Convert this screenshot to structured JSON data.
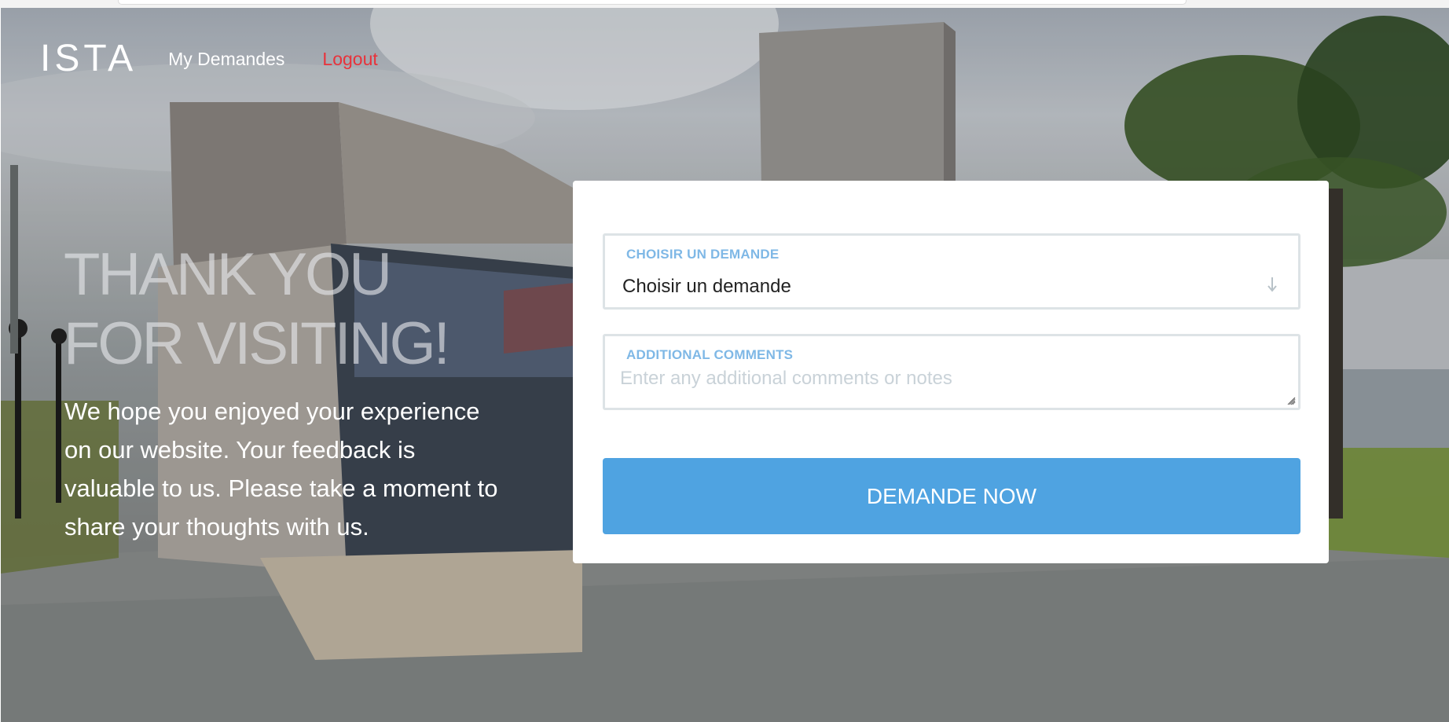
{
  "nav": {
    "logo": "ISTA",
    "links": [
      {
        "label": "My Demandes"
      },
      {
        "label": "Logout"
      }
    ]
  },
  "hero": {
    "headline_line1": "THANK YOU",
    "headline_line2": "FOR VISITING!",
    "subtext": "We hope you enjoyed your experience on our website. Your feedback is valuable to us. Please take a moment to share your thoughts with us."
  },
  "form": {
    "demande_label": "CHOISIR UN DEMANDE",
    "demande_value": "Choisir un demande",
    "comments_label": "ADDITIONAL COMMENTS",
    "comments_placeholder": "Enter any additional comments or notes",
    "submit_label": "DEMANDE NOW"
  },
  "colors": {
    "accent": "#4fa3e1",
    "label": "#7fb8e6",
    "logout": "#e8323a"
  },
  "icons": {
    "select_arrow": "arrow-down-icon",
    "textarea_resize": "resize-handle-icon"
  }
}
